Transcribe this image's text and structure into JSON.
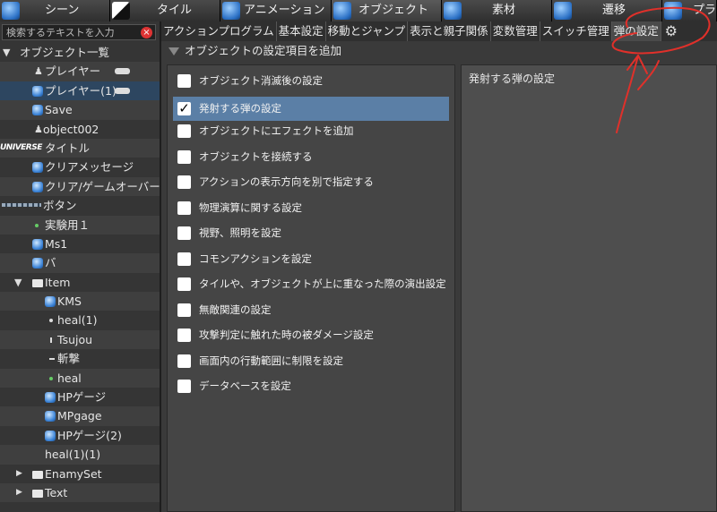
{
  "top_tabs": [
    {
      "label": "シーン"
    },
    {
      "label": "タイル"
    },
    {
      "label": "アニメーション"
    },
    {
      "label": "オブジェクト"
    },
    {
      "label": "素材"
    },
    {
      "label": "遷移"
    },
    {
      "label": "プラ"
    }
  ],
  "search": {
    "placeholder": "検索するテキストを入力"
  },
  "tree": [
    {
      "label": "オブジェクト一覧",
      "icon": "caret-down-icon"
    },
    {
      "label": "プレイヤー",
      "icon": "player-icon"
    },
    {
      "label": "プレイヤー(1)",
      "icon": "object-icon"
    },
    {
      "label": "Save",
      "icon": "object-icon"
    },
    {
      "label": "object002",
      "icon": "player-icon"
    },
    {
      "label": "タイトル",
      "icon": "universe-logo",
      "logo_text": "UNIVERSE"
    },
    {
      "label": "クリアメッセージ",
      "icon": "object-icon"
    },
    {
      "label": "クリア/ゲームオーバー",
      "icon": "object-icon"
    },
    {
      "label": "ボタン",
      "icon": "image-icon"
    },
    {
      "label": "実験用１",
      "icon": "dot-icon"
    },
    {
      "label": "Ms1",
      "icon": "object-icon"
    },
    {
      "label": "バ",
      "icon": "object-icon"
    },
    {
      "label": "Item",
      "icon": "folder-icon"
    },
    {
      "label": "KMS",
      "icon": "object-icon"
    },
    {
      "label": "heal(1)",
      "icon": "dot-icon"
    },
    {
      "label": "Tsujou",
      "icon": "dot-icon"
    },
    {
      "label": "斬撃",
      "icon": "dash-icon"
    },
    {
      "label": "heal",
      "icon": "dot-icon"
    },
    {
      "label": "HPゲージ",
      "icon": "object-icon"
    },
    {
      "label": "MPgage",
      "icon": "object-icon"
    },
    {
      "label": "HPゲージ(2)",
      "icon": "object-icon"
    },
    {
      "label": "heal(1)(1)",
      "icon": "none"
    },
    {
      "label": "EnamySet",
      "icon": "folder-icon"
    },
    {
      "label": "Text",
      "icon": "folder-icon"
    }
  ],
  "sub_tabs": [
    {
      "label": "アクションプログラム"
    },
    {
      "label": "基本設定"
    },
    {
      "label": "移動とジャンプ"
    },
    {
      "label": "表示と親子関係"
    },
    {
      "label": "変数管理"
    },
    {
      "label": "スイッチ管理"
    },
    {
      "label": "弾の設定"
    }
  ],
  "section_header": "オブジェクトの設定項目を追加",
  "options": [
    {
      "label": "オブジェクト消滅後の設定",
      "checked": false
    },
    {
      "label": "発射する弾の設定",
      "checked": true
    },
    {
      "label": "オブジェクトにエフェクトを追加",
      "checked": false
    },
    {
      "label": "オブジェクトを接続する",
      "checked": false
    },
    {
      "label": "アクションの表示方向を別で指定する",
      "checked": false
    },
    {
      "label": "物理演算に関する設定",
      "checked": false
    },
    {
      "label": "視野、照明を設定",
      "checked": false
    },
    {
      "label": "コモンアクションを設定",
      "checked": false
    },
    {
      "label": "タイルや、オブジェクトが上に重なった際の演出設定",
      "checked": false
    },
    {
      "label": "無敵関連の設定",
      "checked": false
    },
    {
      "label": "攻撃判定に触れた時の被ダメージ設定",
      "checked": false
    },
    {
      "label": "画面内の行動範囲に制限を設定",
      "checked": false
    },
    {
      "label": "データベースを設定",
      "checked": false
    }
  ],
  "check_mark": "✓",
  "detail": {
    "title": "発射する弾の設定"
  },
  "colors": {
    "selection": "#5b7fa6",
    "annotation": "#e0302a",
    "clear_button": "#dd3333"
  }
}
